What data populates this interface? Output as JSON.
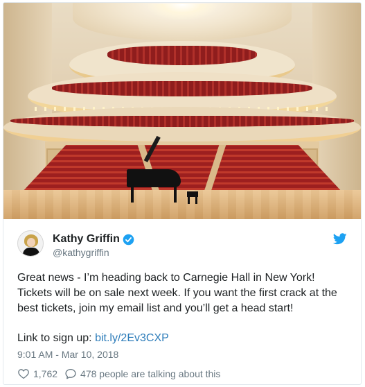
{
  "tweet": {
    "author_name": "Kathy Griffin",
    "author_handle": "@kathygriffin",
    "text_paragraph": "Great news - I’m heading back to Carnegie Hall in New York! Tickets will be on sale next week. If you want the first crack at the best tickets, join my email list and you’ll get a head start!",
    "link_prefix": "Link to sign up: ",
    "link_text": "bit.ly/2Ev3CXP",
    "timestamp": "9:01 AM - Mar 10, 2018",
    "like_count": "1,762",
    "conversation_text": "478 people are talking about this"
  },
  "icons": {
    "verified": "verified-badge-icon",
    "brand": "twitter-bird-icon",
    "like": "heart-icon",
    "reply": "speech-bubble-icon"
  },
  "colors": {
    "text": "#1c2022",
    "secondary": "#697882",
    "link": "#2b7bb9",
    "brand_blue": "#1da1f2",
    "border": "#e1e8ed"
  }
}
